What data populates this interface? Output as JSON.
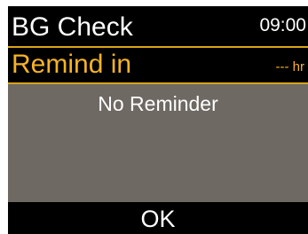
{
  "header": {
    "title": "BG Check",
    "time": "09:00"
  },
  "reminder": {
    "label": "Remind in",
    "value": "--- hr",
    "status": "No Reminder"
  },
  "footer": {
    "ok_label": "OK"
  },
  "colors": {
    "screen_background": "#6e6963",
    "bar_background": "#000000",
    "accent": "#f5b325",
    "divider": "#d9a418",
    "text": "#ffffff"
  }
}
